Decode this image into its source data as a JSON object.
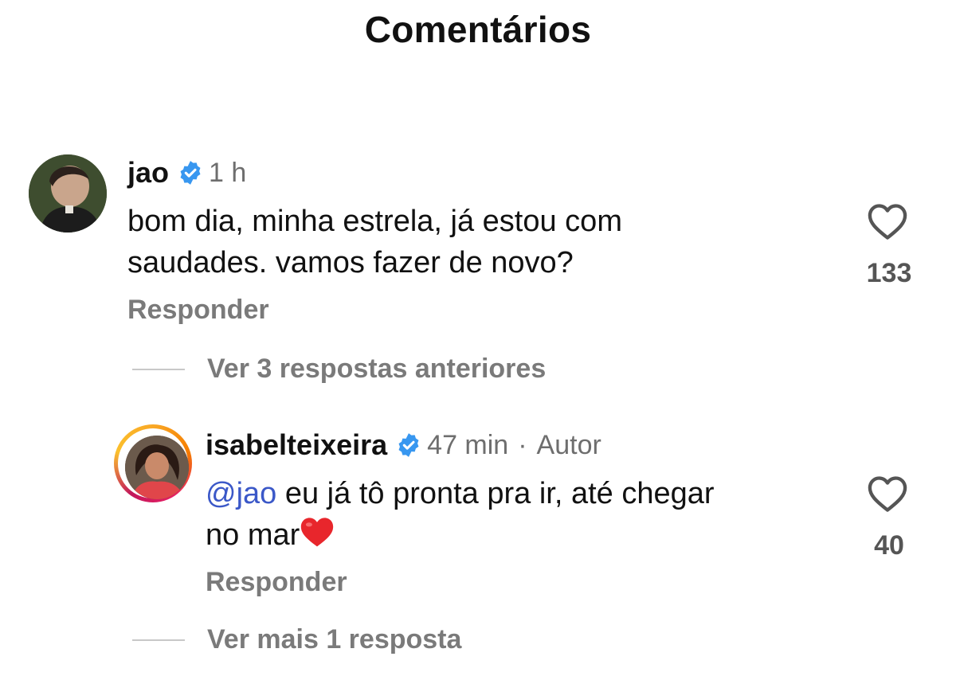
{
  "header": {
    "title": "Comentários"
  },
  "comments": [
    {
      "username": "jao",
      "time": "1 h",
      "text": "bom dia, minha estrela, já estou com saudades. vamos fazer de novo?",
      "text_line1": "bom dia, minha estrela, já estou com",
      "text_line2": "saudades. vamos fazer de novo?",
      "reply_label": "Responder",
      "likes": "133",
      "view_replies": "Ver 3 respostas anteriores",
      "avatar_icon": "profile-photo"
    }
  ],
  "replies": [
    {
      "username": "isabelteixeira",
      "time": "47 min",
      "separator": "·",
      "author_badge": "Autor",
      "mention": "@jao",
      "text_line1": " eu já tô pronta pra ir, até chegar",
      "text_line2": "no mar",
      "emoji": "red-heart",
      "reply_label": "Responder",
      "likes": "40",
      "view_more": "Ver mais 1 resposta",
      "avatar_icon": "profile-photo-story-ring"
    }
  ],
  "colors": {
    "verified": "#3897f0",
    "mention": "#3b58c8",
    "muted": "#7a7a7a",
    "heart_emoji": "#e8262c"
  }
}
